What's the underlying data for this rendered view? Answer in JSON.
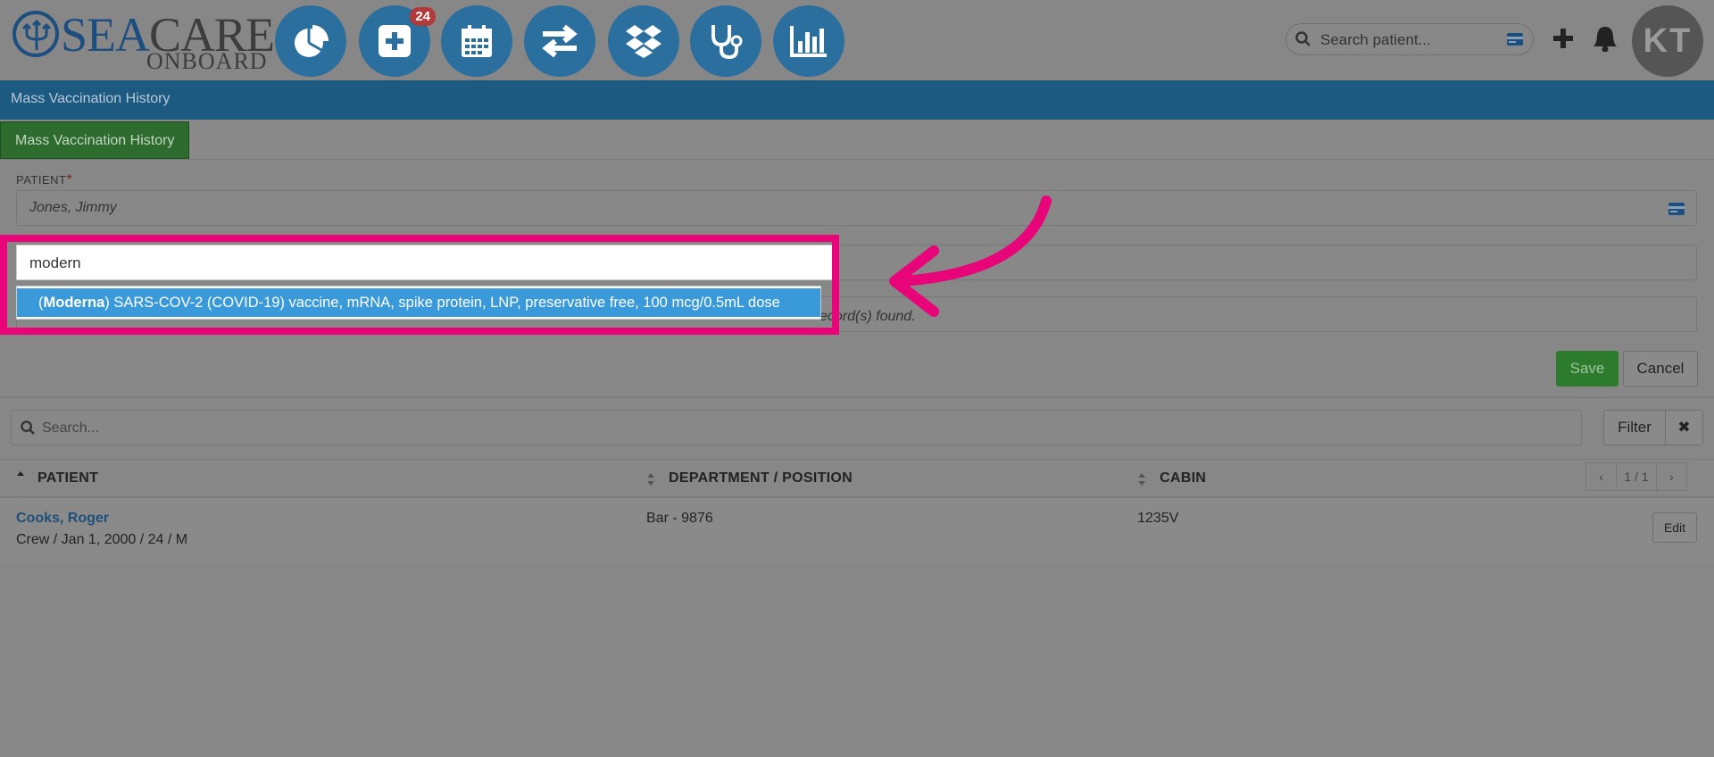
{
  "app": {
    "brand_sea": "SEA",
    "brand_care": "CARE",
    "brand_sub": "ONBOARD"
  },
  "nav": {
    "items": [
      {
        "icon": "pie-chart-icon"
      },
      {
        "icon": "medical-plus-icon",
        "badge": "24"
      },
      {
        "icon": "calendar-icon"
      },
      {
        "icon": "transfer-arrows-icon"
      },
      {
        "icon": "dropbox-icon"
      },
      {
        "icon": "stethoscope-icon"
      },
      {
        "icon": "bar-chart-icon"
      }
    ]
  },
  "header": {
    "search_placeholder": "Search patient...",
    "avatar_initials": "KT"
  },
  "breadcrumb": {
    "title": "Mass Vaccination History"
  },
  "tabs": [
    {
      "label": "Mass Vaccination History",
      "active": true
    }
  ],
  "form": {
    "patient_label": "PATIENT",
    "required_mark": "*",
    "patient_value": "Jones, Jimmy",
    "records_text": "ecord(s) found.",
    "save_label": "Save",
    "cancel_label": "Cancel"
  },
  "autocomplete": {
    "query": "modern",
    "option": {
      "prefix": "(",
      "match": "Moderna",
      "suffix": ") SARS-COV-2 (COVID-19) vaccine, mRNA, spike protein, LNP, preservative free, 100 mcg/0.5mL dose"
    }
  },
  "list": {
    "search_placeholder": "Search...",
    "filter_label": "Filter",
    "clear_label": "✖",
    "columns": [
      "PATIENT",
      "DEPARTMENT / POSITION",
      "CABIN"
    ],
    "pager": {
      "prev": "‹",
      "label": "1 / 1",
      "next": "›"
    },
    "rows": [
      {
        "name": "Cooks, Roger",
        "info": "Crew / Jan 1, 2000 / 24 / M",
        "department": "Bar - 9876",
        "cabin": "1235V",
        "edit_label": "Edit"
      }
    ]
  },
  "colors": {
    "overlay_bg": "#878787",
    "nav_circle": "#2a6f9e",
    "title_bar": "#1d5a82",
    "highlight_border": "#e8057a",
    "option_selected": "#3a9ad9",
    "save_button": "#2d7b2d"
  }
}
